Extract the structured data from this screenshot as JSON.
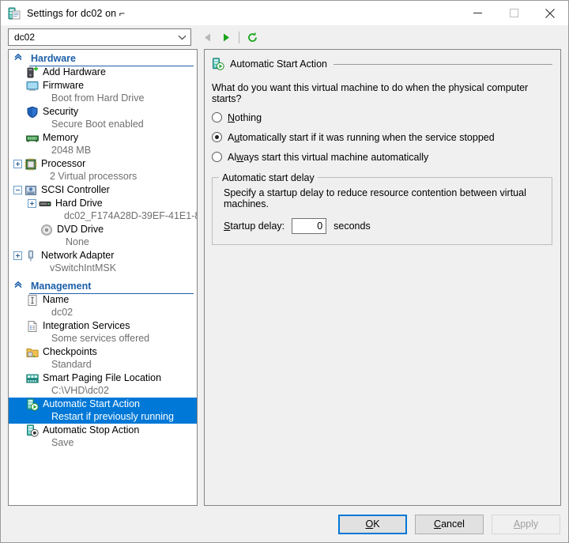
{
  "window": {
    "title": "Settings for dc02 on ⌐",
    "icon": "vm-settings-icon",
    "minimize_label": "Minimize",
    "maximize_label": "Maximize",
    "close_label": "Close"
  },
  "toolbar": {
    "vm_selector_value": "dc02",
    "back_label": "Back",
    "forward_label": "Forward",
    "refresh_label": "Refresh"
  },
  "sidebar": {
    "sections": [
      {
        "label": "Hardware",
        "items": [
          {
            "label": "Add Hardware",
            "sub": "",
            "icon": "add-hardware-icon",
            "expander": "none",
            "indent": 1
          },
          {
            "label": "Firmware",
            "sub": "Boot from Hard Drive",
            "icon": "firmware-icon",
            "expander": "none",
            "indent": 1
          },
          {
            "label": "Security",
            "sub": "Secure Boot enabled",
            "icon": "security-shield-icon",
            "expander": "none",
            "indent": 1
          },
          {
            "label": "Memory",
            "sub": "2048 MB",
            "icon": "memory-icon",
            "expander": "none",
            "indent": 1
          },
          {
            "label": "Processor",
            "sub": "2 Virtual processors",
            "icon": "processor-icon",
            "expander": "plus",
            "indent": 0
          },
          {
            "label": "SCSI Controller",
            "sub": "",
            "icon": "scsi-controller-icon",
            "expander": "minus",
            "indent": 0
          },
          {
            "label": "Hard Drive",
            "sub": "dc02_F174A28D-39EF-41E1-8…",
            "icon": "hard-drive-icon",
            "expander": "plus",
            "indent": 2
          },
          {
            "label": "DVD Drive",
            "sub": "None",
            "icon": "dvd-drive-icon",
            "expander": "none",
            "indent": 2
          },
          {
            "label": "Network Adapter",
            "sub": "vSwitchIntMSK",
            "icon": "network-adapter-icon",
            "expander": "plus",
            "indent": 0
          }
        ]
      },
      {
        "label": "Management",
        "items": [
          {
            "label": "Name",
            "sub": "dc02",
            "icon": "name-icon",
            "expander": "none",
            "indent": 1
          },
          {
            "label": "Integration Services",
            "sub": "Some services offered",
            "icon": "integration-services-icon",
            "expander": "none",
            "indent": 1
          },
          {
            "label": "Checkpoints",
            "sub": "Standard",
            "icon": "checkpoints-icon",
            "expander": "none",
            "indent": 1
          },
          {
            "label": "Smart Paging File Location",
            "sub": "C:\\VHD\\dc02",
            "icon": "smart-paging-icon",
            "expander": "none",
            "indent": 1
          },
          {
            "label": "Automatic Start Action",
            "sub": "Restart if previously running",
            "icon": "auto-start-action-icon",
            "expander": "none",
            "indent": 1,
            "selected": true
          },
          {
            "label": "Automatic Stop Action",
            "sub": "Save",
            "icon": "auto-stop-action-icon",
            "expander": "none",
            "indent": 1
          }
        ]
      }
    ]
  },
  "content": {
    "header": "Automatic Start Action",
    "header_icon": "auto-start-action-icon",
    "prompt": "What do you want this virtual machine to do when the physical computer starts?",
    "options": [
      {
        "label": "Nothing",
        "accesskey_index": 0,
        "selected": false
      },
      {
        "label": "Automatically start if it was running when the service stopped",
        "accesskey_index": 1,
        "selected": true
      },
      {
        "label": "Always start this virtual machine automatically",
        "accesskey_index": 2,
        "selected": false
      }
    ],
    "delay_group": {
      "legend": "Automatic start delay",
      "description": "Specify a startup delay to reduce resource contention between virtual machines.",
      "field_label": "Startup delay:",
      "field_value": "0",
      "unit": "seconds"
    }
  },
  "footer": {
    "ok_label": "OK",
    "cancel_label": "Cancel",
    "apply_label": "Apply"
  },
  "colors": {
    "accent": "#0078d7",
    "section_header": "#1d5fa8",
    "sub_text": "#6f6f6f",
    "green": "#14a01e"
  }
}
